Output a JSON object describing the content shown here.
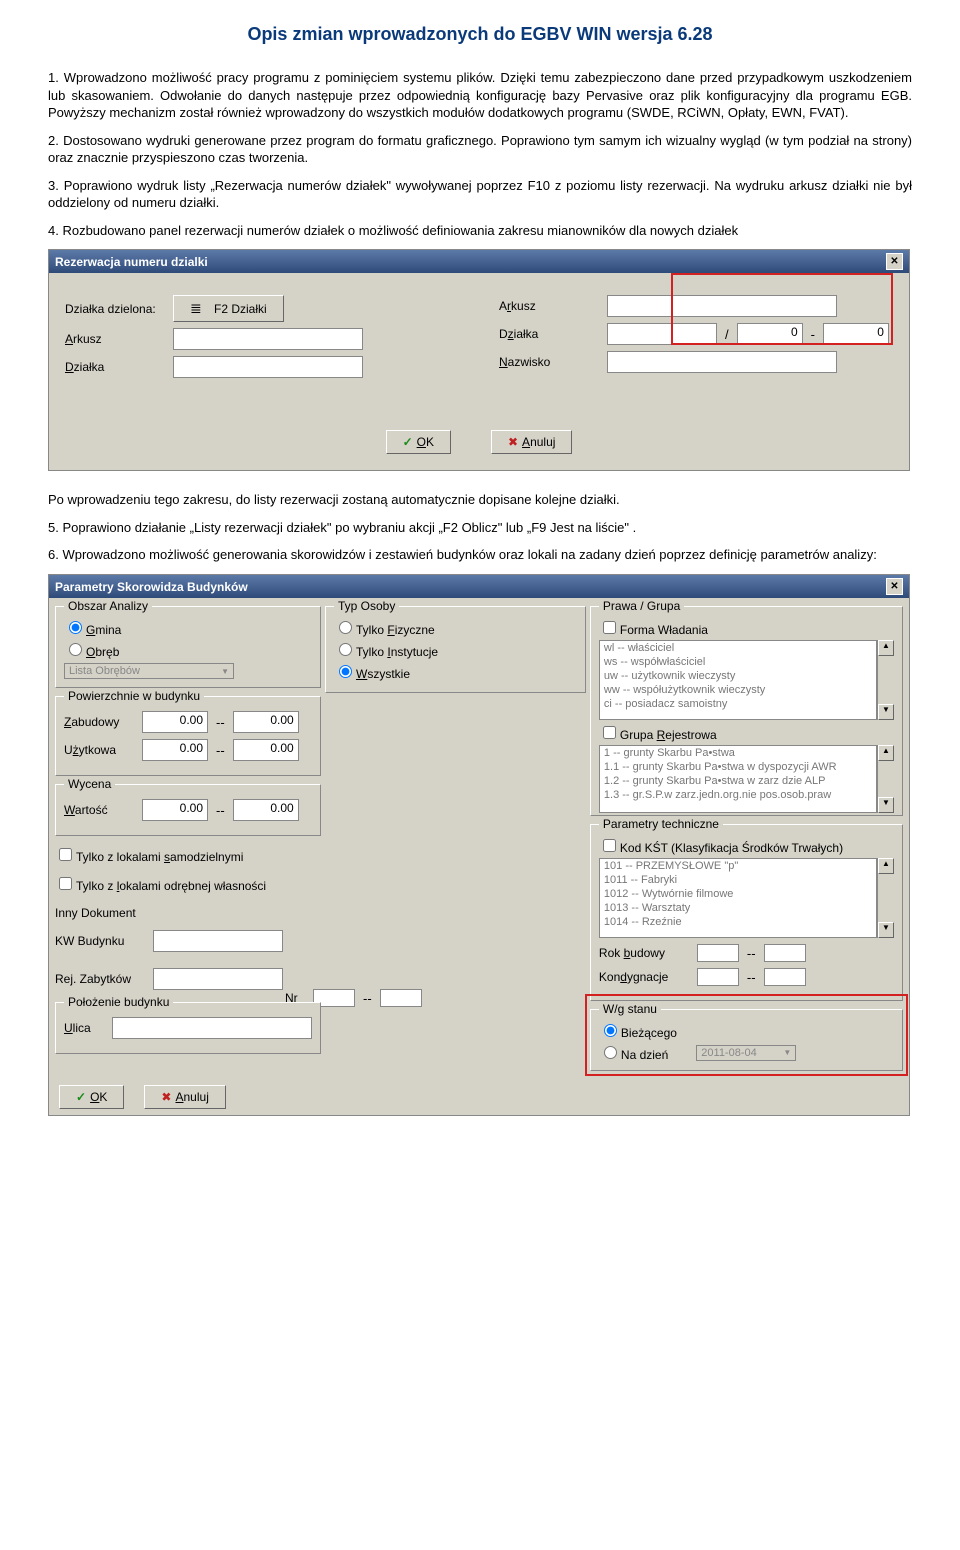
{
  "title": "Opis zmian wprowadzonych do EGBV WIN wersja 6.28",
  "p1": "1. Wprowadzono możliwość pracy programu z pominięciem systemu plików. Dzięki temu zabezpieczono dane przed przypadkowym uszkodzeniem lub skasowaniem. Odwołanie do danych następuje przez odpowiednią konfigurację bazy Pervasive oraz plik konfiguracyjny dla programu EGB. Powyższy mechanizm został również wprowadzony do wszystkich modułów dodatkowych programu (SWDE, RCiWN, Opłaty, EWN, FVAT).",
  "p2": "2. Dostosowano wydruki generowane przez program do formatu graficznego. Poprawiono tym samym ich wizualny wygląd (w tym podział na strony) oraz znacznie przyspieszono czas tworzenia.",
  "p3": "3. Poprawiono wydruk listy „Rezerwacja numerów działek\"  wywoływanej poprzez F10 z poziomu listy rezerwacji. Na wydruku arkusz działki nie był oddzielony od numeru działki.",
  "p4": "4. Rozbudowano panel rezerwacji numerów działek o możliwość definiowania zakresu mianowników dla nowych działek",
  "dlg1": {
    "title": "Rezerwacja numeru dzialki",
    "left": {
      "dzielona": "Działka dzielona:",
      "f2btn": "F2 Działki",
      "arkusz": "Arkusz",
      "dzialka": "Działka"
    },
    "right": {
      "arkusz": "Arkusz",
      "dzialka": "Działka",
      "nazwisko": "Nazwisko"
    },
    "slash": "/",
    "dash": "-",
    "v0": "0",
    "v0b": "0",
    "ok": "OK",
    "anuluj": "Anuluj"
  },
  "p5": "Po wprowadzeniu tego zakresu, do listy rezerwacji zostaną automatycznie dopisane kolejne działki.",
  "p6": "5. Poprawiono działanie „Listy rezerwacji działek\" po wybraniu akcji „F2 Oblicz\" lub „F9 Jest na liście\" .",
  "p7": "6. Wprowadzono możliwość generowania skorowidzów i zestawień budynków oraz lokali na zadany dzień poprzez definicję parametrów analizy:",
  "dlg2": {
    "title": "Parametry Skorowidza Budynków",
    "obszar": {
      "title": "Obszar Analizy",
      "gmina": "Gmina",
      "obreb": "Obręb",
      "lista": "Lista Obrębów"
    },
    "pow": {
      "title": "Powierzchnie w budynku",
      "zab": "Zabudowy",
      "uzy": "Użytkowa",
      "v": "0.00",
      "sep": "--"
    },
    "wyc": {
      "title": "Wycena",
      "wart": "Wartość",
      "v": "0.00",
      "sep": "--"
    },
    "chk1": "Tylko z lokalami samodzielnymi",
    "chk2": "Tylko z lokalami odrębnej własności",
    "innyDok": "Inny Dokument",
    "kw": "KW Budynku",
    "rej": "Rej. Zabytków",
    "poloz": {
      "title": "Położenie budynku",
      "ulica": "Ulica",
      "nr": "Nr",
      "sep": "--"
    },
    "typOsoby": {
      "title": "Typ Osoby",
      "fiz": "Tylko Fizyczne",
      "inst": "Tylko Instytucje",
      "wsz": "Wszystkie"
    },
    "prawa": {
      "title": "Prawa  / Grupa",
      "forma": "Forma Władania",
      "items": [
        "wl    -- właściciel",
        "ws   -- współwłaściciel",
        "uw   -- użytkownik wieczysty",
        "ww  -- współużytkownik wieczysty",
        "ci     -- posiadacz samoistny"
      ],
      "grupa": "Grupa Rejestrowa",
      "gitems": [
        "1      -- grunty Skarbu Pa•stwa",
        "1.1   -- grunty Skarbu Pa•stwa w dyspozycji AWR",
        "1.2   -- grunty Skarbu Pa•stwa w zarz dzie ALP",
        "1.3   -- gr.S.P.w zarz.jedn.org.nie pos.osob.praw"
      ]
    },
    "tech": {
      "title": "Parametry techniczne",
      "kod": "Kod KŚT (Klasyfikacja Środków Trwałych)",
      "items": [
        "101     -- PRZEMYSŁOWE   \"p\"",
        "1011   -- Fabryki",
        "1012   -- Wytwórnie filmowe",
        "1013   -- Warsztaty",
        "1014   -- Rzeźnie"
      ],
      "rok": "Rok budowy",
      "kond": "Kondygnacje",
      "sep": "--"
    },
    "stan": {
      "title": "W/g stanu",
      "biez": "Bieżącego",
      "nadz": "Na dzień",
      "date": "2011-08-04"
    },
    "ok": "OK",
    "anuluj": "Anuluj"
  }
}
